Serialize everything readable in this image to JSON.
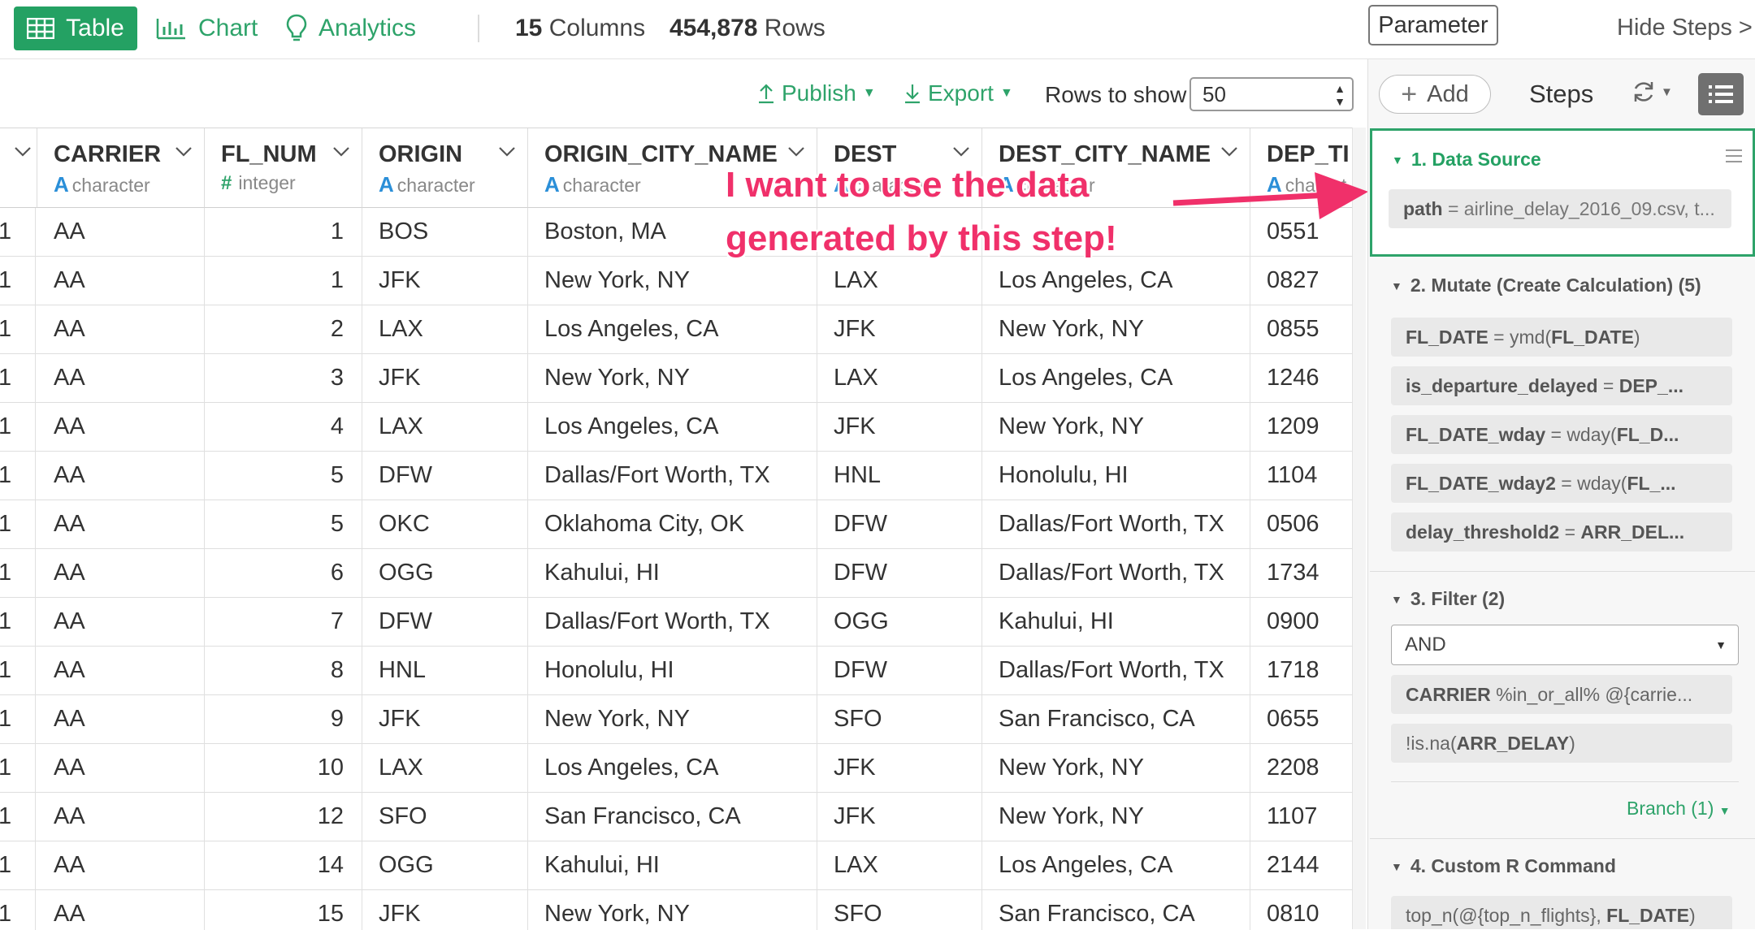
{
  "toolbar": {
    "tabs": [
      {
        "label": "Table",
        "icon": "table-icon",
        "active": true
      },
      {
        "label": "Chart",
        "icon": "bar-chart-icon",
        "active": false
      },
      {
        "label": "Analytics",
        "icon": "lightbulb-icon",
        "active": false
      }
    ],
    "columns_count": "15",
    "columns_label": "Columns",
    "rows_count": "454,878",
    "rows_label": "Rows",
    "parameter_label": "Parameter",
    "hide_steps_label": "Hide Steps >"
  },
  "actions": {
    "publish_label": "Publish",
    "export_label": "Export",
    "rows_to_show_label": "Rows to show",
    "rows_to_show_value": "50"
  },
  "table": {
    "columns": [
      {
        "name": "",
        "type": ""
      },
      {
        "name": "CARRIER",
        "type": "character",
        "type_icon": "A"
      },
      {
        "name": "FL_NUM",
        "type": "integer",
        "type_icon": "#"
      },
      {
        "name": "ORIGIN",
        "type": "character",
        "type_icon": "A"
      },
      {
        "name": "ORIGIN_CITY_NAME",
        "type": "character",
        "type_icon": "A"
      },
      {
        "name": "DEST",
        "type": "character",
        "type_icon": "A"
      },
      {
        "name": "DEST_CITY_NAME",
        "type": "character",
        "type_icon": "A"
      },
      {
        "name": "DEP_TI",
        "type": "charact",
        "type_icon": "A"
      }
    ],
    "rows": [
      [
        "1",
        "AA",
        "1",
        "BOS",
        "Boston, MA",
        "",
        "",
        "0551"
      ],
      [
        "1",
        "AA",
        "1",
        "JFK",
        "New York, NY",
        "LAX",
        "Los Angeles, CA",
        "0827"
      ],
      [
        "1",
        "AA",
        "2",
        "LAX",
        "Los Angeles, CA",
        "JFK",
        "New York, NY",
        "0855"
      ],
      [
        "1",
        "AA",
        "3",
        "JFK",
        "New York, NY",
        "LAX",
        "Los Angeles, CA",
        "1246"
      ],
      [
        "1",
        "AA",
        "4",
        "LAX",
        "Los Angeles, CA",
        "JFK",
        "New York, NY",
        "1209"
      ],
      [
        "1",
        "AA",
        "5",
        "DFW",
        "Dallas/Fort Worth, TX",
        "HNL",
        "Honolulu, HI",
        "1104"
      ],
      [
        "1",
        "AA",
        "5",
        "OKC",
        "Oklahoma City, OK",
        "DFW",
        "Dallas/Fort Worth, TX",
        "0506"
      ],
      [
        "1",
        "AA",
        "6",
        "OGG",
        "Kahului, HI",
        "DFW",
        "Dallas/Fort Worth, TX",
        "1734"
      ],
      [
        "1",
        "AA",
        "7",
        "DFW",
        "Dallas/Fort Worth, TX",
        "OGG",
        "Kahului, HI",
        "0900"
      ],
      [
        "1",
        "AA",
        "8",
        "HNL",
        "Honolulu, HI",
        "DFW",
        "Dallas/Fort Worth, TX",
        "1718"
      ],
      [
        "1",
        "AA",
        "9",
        "JFK",
        "New York, NY",
        "SFO",
        "San Francisco, CA",
        "0655"
      ],
      [
        "1",
        "AA",
        "10",
        "LAX",
        "Los Angeles, CA",
        "JFK",
        "New York, NY",
        "2208"
      ],
      [
        "1",
        "AA",
        "12",
        "SFO",
        "San Francisco, CA",
        "JFK",
        "New York, NY",
        "1107"
      ],
      [
        "1",
        "AA",
        "14",
        "OGG",
        "Kahului, HI",
        "LAX",
        "Los Angeles, CA",
        "2144"
      ],
      [
        "1",
        "AA",
        "15",
        "JFK",
        "New York, NY",
        "SFO",
        "San Francisco, CA",
        "0810"
      ]
    ]
  },
  "annotation": {
    "line1": "I want to use the data",
    "line2": "generated by this step!",
    "color": "#f0306a"
  },
  "steps": {
    "add_label": "Add",
    "title": "Steps",
    "items": [
      {
        "title": "1. Data Source",
        "chips": [
          {
            "bold": "path",
            "rest": " = airline_delay_2016_09.csv, t..."
          }
        ]
      },
      {
        "title": "2. Mutate (Create Calculation) (5)",
        "chips": [
          {
            "bold": "FL_DATE",
            "rest": " = ymd(",
            "bold2": "FL_DATE",
            "rest2": ")"
          },
          {
            "bold": "is_departure_delayed",
            "rest": " = ",
            "bold2": "DEP_...",
            "rest2": ""
          },
          {
            "bold": "FL_DATE_wday",
            "rest": " = wday(",
            "bold2": "FL_D...",
            "rest2": ""
          },
          {
            "bold": "FL_DATE_wday2",
            "rest": " = wday(",
            "bold2": "FL_...",
            "rest2": ""
          },
          {
            "bold": "delay_threshold2",
            "rest": " = ",
            "bold2": "ARR_DEL...",
            "rest2": ""
          }
        ]
      },
      {
        "title": "3. Filter (2)",
        "logic": "AND",
        "chips": [
          {
            "bold": "CARRIER",
            "rest": " %in_or_all% @{carrie...",
            "bold2": "",
            "rest2": ""
          },
          {
            "bold": "",
            "rest": "!is.na(",
            "bold2": "ARR_DELAY",
            "rest2": ")"
          }
        ],
        "branch_label": "Branch (1)"
      },
      {
        "title": "4. Custom R Command",
        "chips": [
          {
            "bold": "",
            "rest": "top_n(@{top_n_flights}, ",
            "bold2": "FL_DATE",
            "rest2": ")"
          }
        ]
      }
    ]
  },
  "colors": {
    "accent": "#24a163",
    "annotation": "#f0306a",
    "type_icon": "#2b8fd8"
  }
}
